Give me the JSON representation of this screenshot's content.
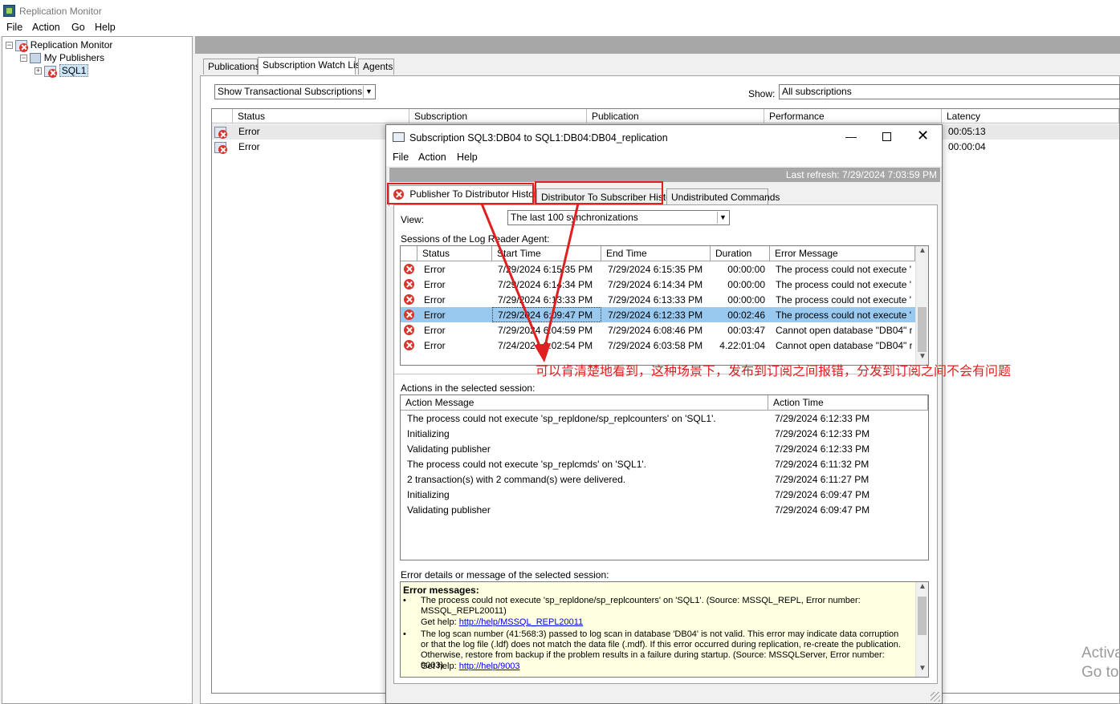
{
  "window": {
    "title": "Replication Monitor"
  },
  "menu": [
    "File",
    "Action",
    "Go",
    "Help"
  ],
  "tree": {
    "root": "Replication Monitor",
    "publishers": "My Publishers",
    "server": "SQL1"
  },
  "main_tabs": [
    "Publications",
    "Subscription Watch List",
    "Agents"
  ],
  "filter_select": "Show Transactional Subscriptions",
  "show_label": "Show:",
  "show_select": "All subscriptions",
  "watch_grid": {
    "headers": [
      "Status",
      "Subscription",
      "Publication",
      "Performance",
      "Latency"
    ],
    "rows": [
      {
        "status": "Error",
        "latency": "00:05:13"
      },
      {
        "status": "Error",
        "latency": "00:00:04"
      }
    ]
  },
  "dialog": {
    "title": "Subscription SQL3:DB04 to SQL1:DB04:DB04_replication",
    "menu": [
      "File",
      "Action",
      "Help"
    ],
    "last_refresh": "Last refresh: 7/29/2024 7:03:59 PM",
    "tabs": [
      "Publisher To Distributor History",
      "Distributor To Subscriber History",
      "Undistributed Commands"
    ],
    "view_label": "View:",
    "view_select": "The last 100 synchronizations",
    "sessions_label": "Sessions of the Log Reader Agent:",
    "sessions_headers": [
      "Status",
      "Start Time",
      "End Time",
      "Duration",
      "Error Message"
    ],
    "sessions": [
      {
        "status": "Error",
        "start": "7/29/2024 6:15:35 PM",
        "end": "7/29/2024 6:15:35 PM",
        "duration": "00:00:00",
        "error": "The process could not execute '..."
      },
      {
        "status": "Error",
        "start": "7/29/2024 6:14:34 PM",
        "end": "7/29/2024 6:14:34 PM",
        "duration": "00:00:00",
        "error": "The process could not execute '..."
      },
      {
        "status": "Error",
        "start": "7/29/2024 6:13:33 PM",
        "end": "7/29/2024 6:13:33 PM",
        "duration": "00:00:00",
        "error": "The process could not execute '..."
      },
      {
        "status": "Error",
        "start": "7/29/2024 6:09:47 PM",
        "end": "7/29/2024 6:12:33 PM",
        "duration": "00:02:46",
        "error": "The process could not execute '..."
      },
      {
        "status": "Error",
        "start": "7/29/2024 6:04:59 PM",
        "end": "7/29/2024 6:08:46 PM",
        "duration": "00:03:47",
        "error": "Cannot open database \"DB04\" r..."
      },
      {
        "status": "Error",
        "start": "7/24/2024 8:02:54 PM",
        "end": "7/29/2024 6:03:58 PM",
        "duration": "4.22:01:04",
        "error": "Cannot open database \"DB04\" r..."
      }
    ],
    "actions_label": "Actions in the selected session:",
    "actions_headers": [
      "Action Message",
      "Action Time"
    ],
    "actions": [
      {
        "message": "The process could not execute 'sp_repldone/sp_replcounters' on 'SQL1'.",
        "time": "7/29/2024 6:12:33 PM"
      },
      {
        "message": "Initializing",
        "time": "7/29/2024 6:12:33 PM"
      },
      {
        "message": "Validating publisher",
        "time": "7/29/2024 6:12:33 PM"
      },
      {
        "message": "The process could not execute 'sp_replcmds' on 'SQL1'.",
        "time": "7/29/2024 6:11:32 PM"
      },
      {
        "message": "2 transaction(s) with 2 command(s) were delivered.",
        "time": "7/29/2024 6:11:27 PM"
      },
      {
        "message": "Initializing",
        "time": "7/29/2024 6:09:47 PM"
      },
      {
        "message": "Validating publisher",
        "time": "7/29/2024 6:09:47 PM"
      }
    ],
    "details_label": "Error details or message of the selected session:",
    "details": {
      "heading": "Error messages:",
      "msg1": "The process could not execute 'sp_repldone/sp_replcounters' on 'SQL1'. (Source: MSSQL_REPL, Error number: MSSQL_REPL20011)",
      "help_label": "Get help:",
      "link1": "http://help/MSSQL_REPL20011",
      "msg2": "The log scan number (41:568:3) passed to log scan in database 'DB04' is not valid. This error may indicate data corruption or that the log file (.ldf) does not match the data file (.mdf). If this error occurred during replication, re-create the publication. Otherwise, restore from backup if the problem results in a failure during startup. (Source: MSSQLServer, Error number: 9003)",
      "link2": "http://help/9003"
    }
  },
  "annotation": "可以肯清楚地看到，这种场景下，发布到订阅之间报错，分发到订阅之间不会有问题",
  "watermark": "Activa\nGo to S"
}
